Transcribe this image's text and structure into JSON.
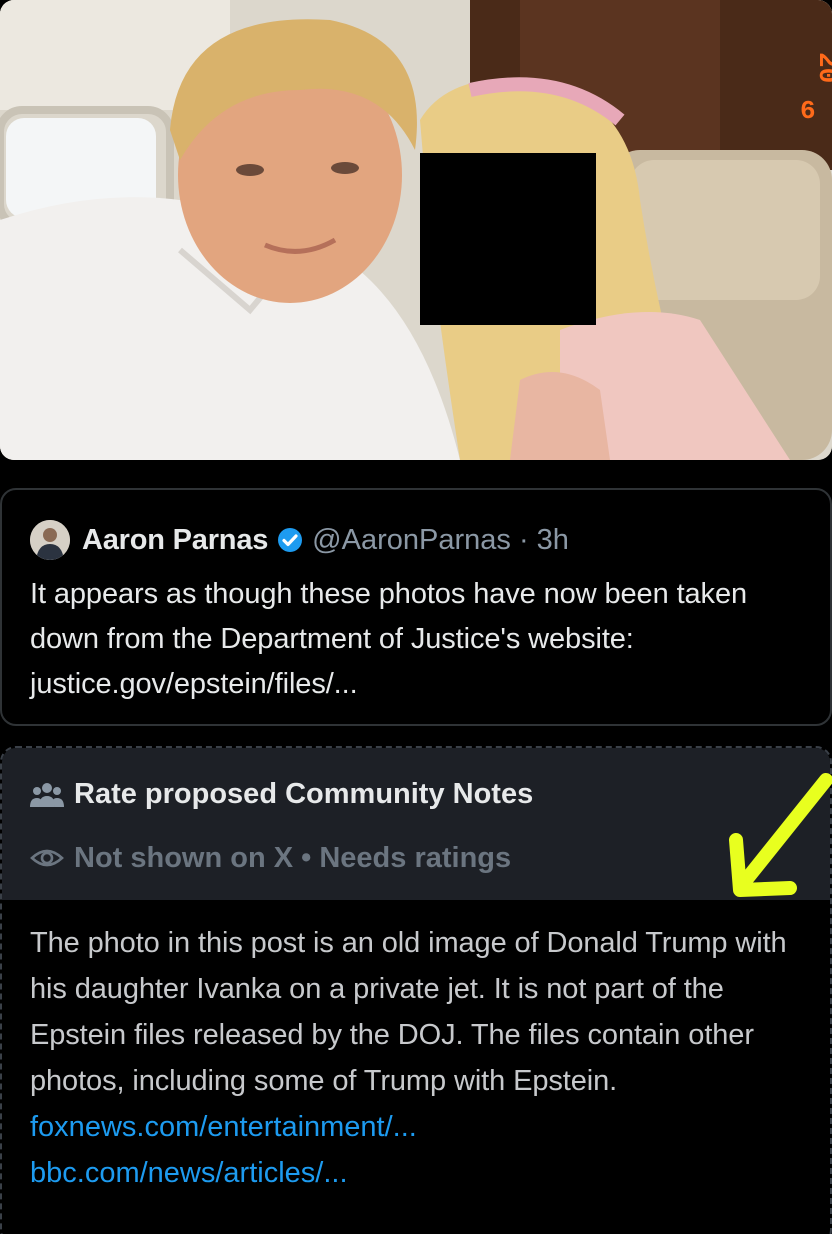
{
  "photo": {
    "alt_subject": "photo",
    "date_stamp": "20 6"
  },
  "quote": {
    "author_name": "Aaron Parnas",
    "handle": "@AaronParnas · 3h",
    "text": "It appears as though these photos have now been taken down from the Department of Justice's website: justice.gov/epstein/files/..."
  },
  "community_notes": {
    "title": "Rate proposed Community Notes",
    "status": "Not shown on X • Needs ratings",
    "note_text": "The photo in this post is an old image of Donald Trump with his daughter Ivanka on a private jet. It is not part of the Epstein files released by the DOJ. The files contain other photos, including some of Trump with Epstein.",
    "links": [
      "foxnews.com/entertainment/...",
      "bbc.com/news/articles/..."
    ]
  },
  "colors": {
    "background": "#000000",
    "text_primary": "#e7e9ea",
    "text_secondary": "#8b98a5",
    "link": "#1d9bf0",
    "verified": "#1d9bf0",
    "arrow": "#e8ff1f"
  },
  "icons": [
    "verified-badge-icon",
    "people-icon",
    "eye-icon",
    "arrow-icon"
  ]
}
